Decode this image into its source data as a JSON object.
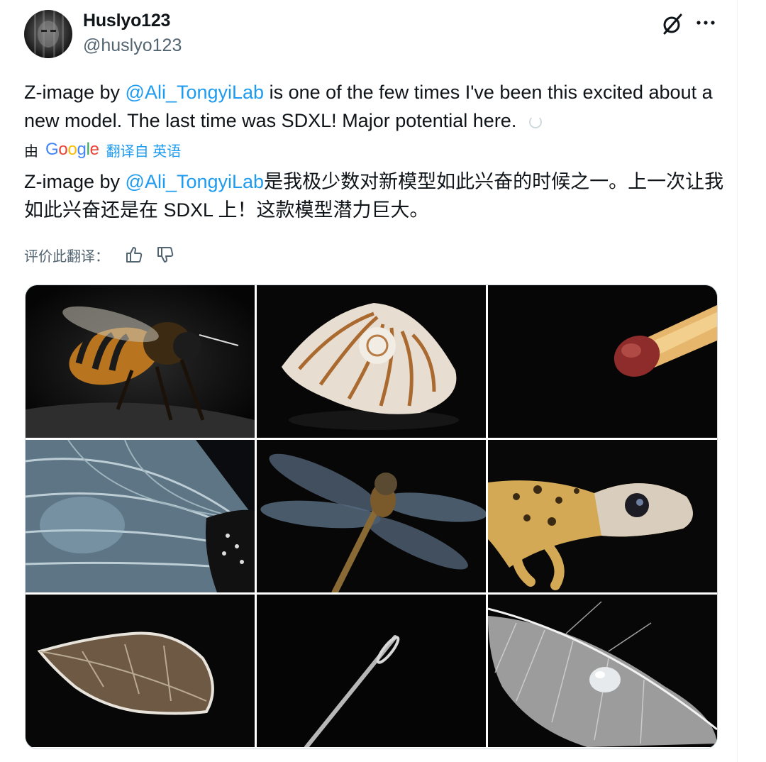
{
  "author": {
    "display_name": "Huslyo123",
    "handle": "@huslyo123"
  },
  "icons": {
    "avatar": "avatar",
    "grok": "grok-icon",
    "more": "more-icon",
    "thumbs_up": "thumbs-up-icon",
    "thumbs_down": "thumbs-down-icon",
    "spinner": "spinner-icon"
  },
  "tweet": {
    "text_before": "Z-image by ",
    "mention": "@Ali_TongyiLab",
    "text_after": " is one of the few times I've been this excited about a new model. The last time was SDXL! Major potential here."
  },
  "translation": {
    "by_label": "由",
    "provider": "Google",
    "link_label": "翻译自 英语",
    "text_before": "Z-image by ",
    "mention": "@Ali_TongyiLab",
    "text_after": "是我极少数对新模型如此兴奋的时候之一。上一次让我如此兴奋还是在 SDXL 上！这款模型潜力巨大。",
    "rate_label": "评价此翻译："
  },
  "media": {
    "images": [
      "bee",
      "seashell",
      "matchstick",
      "butterfly-wing",
      "dragonfly",
      "gecko",
      "frosted-leaf",
      "needle",
      "feather"
    ]
  },
  "colors": {
    "accent": "#1d9bf0",
    "text": "#0f1419",
    "secondary": "#536471",
    "border": "#cfd9de"
  }
}
